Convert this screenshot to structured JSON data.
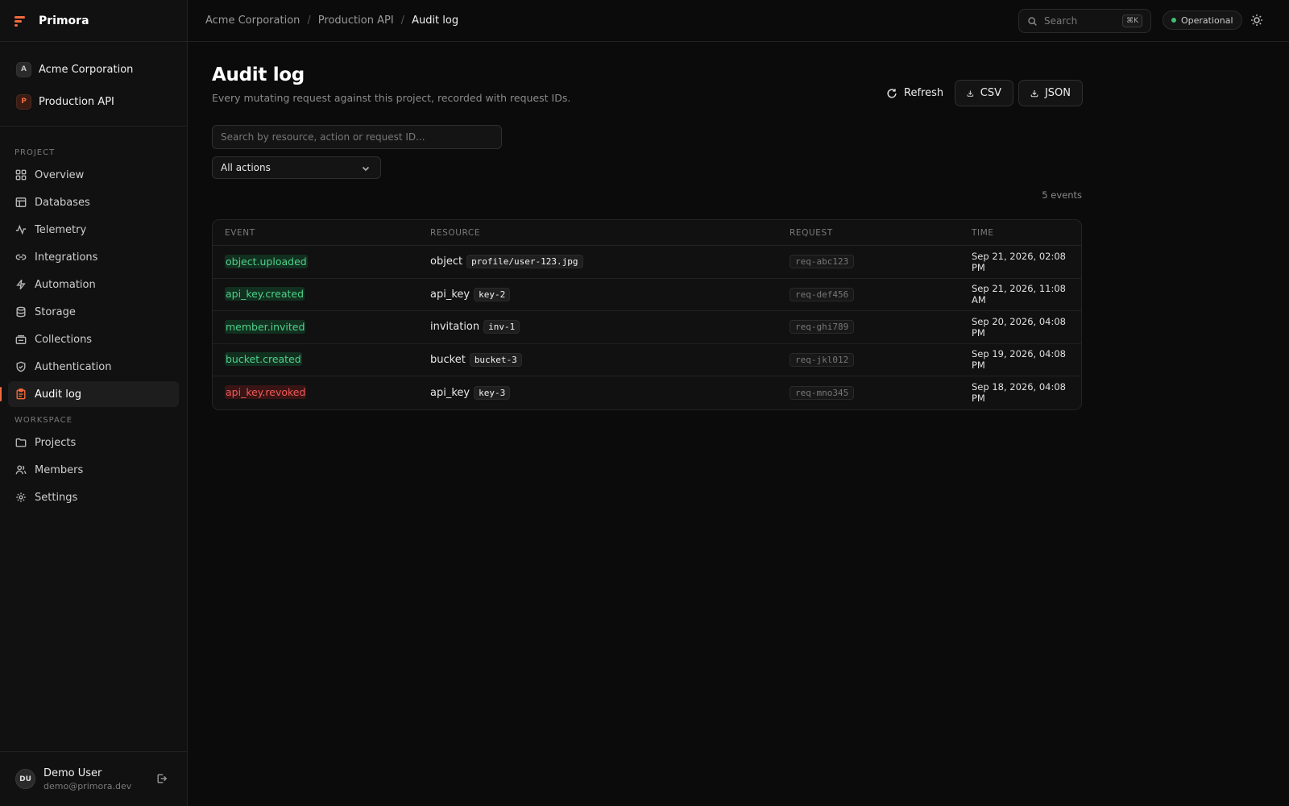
{
  "brand": {
    "name": "Primora"
  },
  "switchers": {
    "org": {
      "badge": "A",
      "label": "Acme Corporation"
    },
    "project": {
      "badge": "P",
      "label": "Production API"
    }
  },
  "sidebar": {
    "project_heading": "PROJECT",
    "project_items": [
      {
        "label": "Overview",
        "icon": "grid-icon"
      },
      {
        "label": "Databases",
        "icon": "table-icon"
      },
      {
        "label": "Telemetry",
        "icon": "activity-icon"
      },
      {
        "label": "Integrations",
        "icon": "link-icon"
      },
      {
        "label": "Automation",
        "icon": "bolt-icon"
      },
      {
        "label": "Storage",
        "icon": "database-icon"
      },
      {
        "label": "Collections",
        "icon": "layers-icon"
      },
      {
        "label": "Authentication",
        "icon": "shield-icon"
      },
      {
        "label": "Audit log",
        "icon": "clipboard-icon",
        "active": true
      }
    ],
    "workspace_heading": "WORKSPACE",
    "workspace_items": [
      {
        "label": "Projects",
        "icon": "folder-icon"
      },
      {
        "label": "Members",
        "icon": "users-icon"
      },
      {
        "label": "Settings",
        "icon": "gear-icon"
      }
    ]
  },
  "user": {
    "initials": "DU",
    "name": "Demo User",
    "email": "demo@primora.dev"
  },
  "topbar": {
    "breadcrumb": [
      "Acme Corporation",
      "Production API",
      "Audit log"
    ],
    "search_placeholder": "Search",
    "search_shortcut": "⌘K",
    "status": "Operational"
  },
  "page": {
    "title": "Audit log",
    "subtitle": "Every mutating request against this project, recorded with request IDs.",
    "refresh_label": "Refresh",
    "csv_label": "CSV",
    "json_label": "JSON",
    "filter_placeholder": "Search by resource, action or request ID...",
    "action_filter": "All actions",
    "event_count": "5 events"
  },
  "table": {
    "columns": [
      "EVENT",
      "RESOURCE",
      "REQUEST",
      "TIME"
    ],
    "rows": [
      {
        "event": "object.uploaded",
        "tone": "green",
        "resource_type": "object",
        "resource_id": "profile/user-123.jpg",
        "request": "req-abc123",
        "time": "Sep 21, 2026, 02:08 PM"
      },
      {
        "event": "api_key.created",
        "tone": "green",
        "resource_type": "api_key",
        "resource_id": "key-2",
        "request": "req-def456",
        "time": "Sep 21, 2026, 11:08 AM"
      },
      {
        "event": "member.invited",
        "tone": "green",
        "resource_type": "invitation",
        "resource_id": "inv-1",
        "request": "req-ghi789",
        "time": "Sep 20, 2026, 04:08 PM"
      },
      {
        "event": "bucket.created",
        "tone": "green",
        "resource_type": "bucket",
        "resource_id": "bucket-3",
        "request": "req-jkl012",
        "time": "Sep 19, 2026, 04:08 PM"
      },
      {
        "event": "api_key.revoked",
        "tone": "red",
        "resource_type": "api_key",
        "resource_id": "key-3",
        "request": "req-mno345",
        "time": "Sep 18, 2026, 04:08 PM"
      }
    ]
  },
  "colors": {
    "accent": "#f26a3d",
    "success": "#4fd08a",
    "danger": "#f05a5a",
    "status_dot": "#3fbf73"
  }
}
